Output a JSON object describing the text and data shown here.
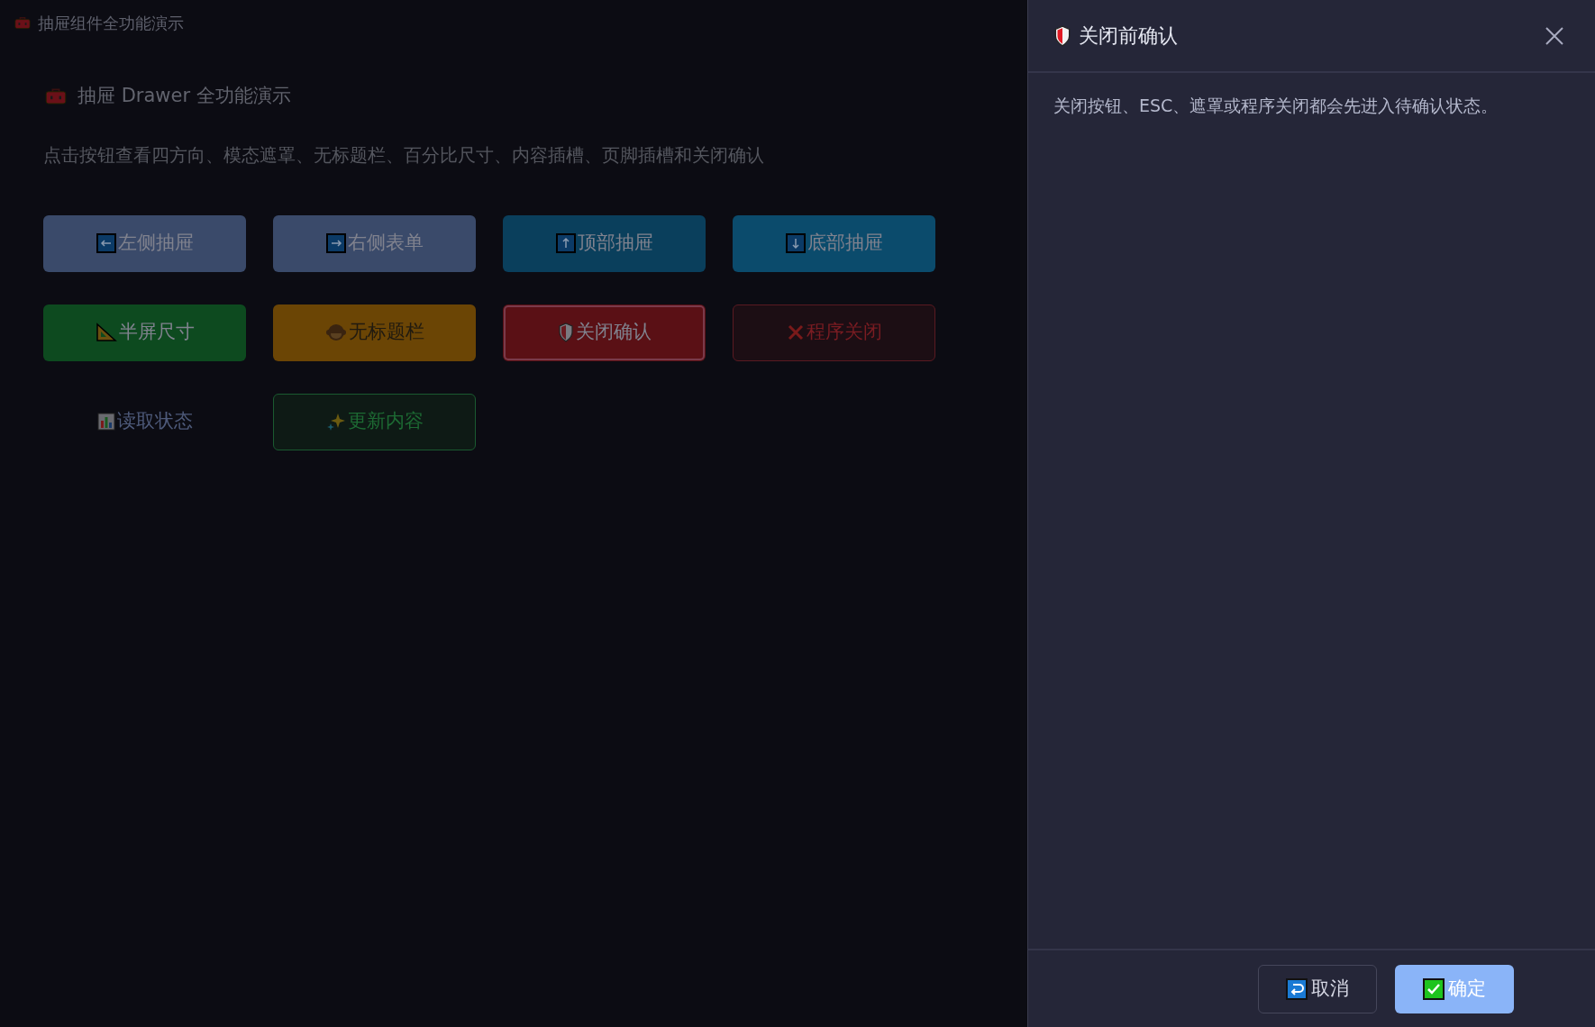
{
  "window": {
    "title": "抽屉组件全功能演示"
  },
  "heading": "抽屉 Drawer 全功能演示",
  "subtitle": "点击按钮查看四方向、模态遮罩、无标题栏、百分比尺寸、内容插槽、页脚插槽和关闭确认",
  "buttons": [
    {
      "label": "左侧抽屉",
      "kind": "slate",
      "focused": false
    },
    {
      "label": "右侧表单",
      "kind": "slate",
      "focused": false
    },
    {
      "label": "顶部抽屉",
      "kind": "ocean",
      "focused": false
    },
    {
      "label": "底部抽屉",
      "kind": "sky",
      "focused": false
    },
    {
      "label": "半屏尺寸",
      "kind": "success",
      "focused": false
    },
    {
      "label": "无标题栏",
      "kind": "warning",
      "focused": false
    },
    {
      "label": "关闭确认",
      "kind": "danger",
      "focused": true
    },
    {
      "label": "程序关闭",
      "kind": "danger-outline",
      "focused": false
    },
    {
      "label": "读取状态",
      "kind": "text",
      "focused": false
    },
    {
      "label": "更新内容",
      "kind": "success-outline",
      "focused": false
    }
  ],
  "drawer": {
    "title": "关闭前确认",
    "body": "关闭按钮、ESC、遮罩或程序关闭都会先进入待确认状态。",
    "footer_buttons": [
      {
        "label": "取消",
        "kind": "default"
      },
      {
        "label": "确定",
        "kind": "primary"
      }
    ]
  }
}
